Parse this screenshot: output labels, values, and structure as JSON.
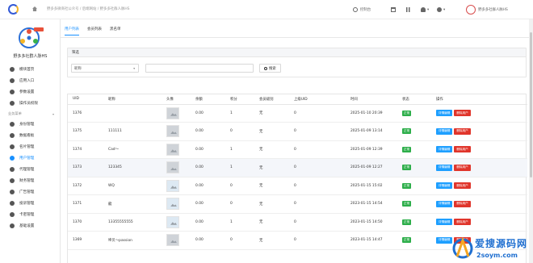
{
  "topbar": {
    "breadcrumb": "野多多微商社公众号 / 后端网站 / 野多多社群人脉HS",
    "links": [
      {
        "icon": "gear-icon",
        "label": "控制台"
      },
      {
        "icon": "calendar-icon",
        "label": ""
      },
      {
        "icon": "grid-icon",
        "label": ""
      },
      {
        "icon": "bell-icon",
        "label": "▾"
      },
      {
        "icon": "user-icon",
        "label": "▾"
      }
    ],
    "user_name": "野多多社群人脉HS"
  },
  "sidebar": {
    "brand_name": "野多多社群人脉HS",
    "top_items": [
      {
        "label": "模块首页",
        "icon": "home-icon"
      },
      {
        "label": "应用入口",
        "icon": "apps-icon"
      },
      {
        "label": "参数设置",
        "icon": "settings-icon"
      },
      {
        "label": "操作员权限",
        "icon": "permission-icon"
      }
    ],
    "group_label": "业务菜单",
    "group_items": [
      {
        "label": "身份管理",
        "icon": "gear-icon"
      },
      {
        "label": "数据看板",
        "icon": "gear-icon"
      },
      {
        "label": "名片管理",
        "icon": "gear-icon"
      },
      {
        "label": "用户管理",
        "icon": "gear-icon",
        "active": true
      },
      {
        "label": "代理管理",
        "icon": "gear-icon"
      },
      {
        "label": "财务管理",
        "icon": "gear-icon"
      },
      {
        "label": "广告管理",
        "icon": "gear-icon"
      },
      {
        "label": "投诉管理",
        "icon": "gear-icon"
      },
      {
        "label": "卡密管理",
        "icon": "gear-icon"
      },
      {
        "label": "基础设置",
        "icon": "gear-icon"
      }
    ]
  },
  "tabs": [
    "用户列表",
    "会员列表",
    "黑名单"
  ],
  "filter": {
    "title": "筛选",
    "select_value": "昵称",
    "input_value": "",
    "search_label": "搜索"
  },
  "table": {
    "headers": [
      "UID",
      "昵称",
      "头像",
      "余额",
      "积分",
      "会员级别",
      "上级UID",
      "时间",
      "状态",
      "操作"
    ],
    "status_label": "正常",
    "detail_label": "详情编辑",
    "delete_label": "删除用户",
    "rows": [
      {
        "uid": "1376",
        "nick": "",
        "balance": "0.00",
        "points": "1",
        "level": "无",
        "parent": "0",
        "time": "2025-01-10 20:39"
      },
      {
        "uid": "1375",
        "nick": "111111",
        "balance": "0.00",
        "points": "0",
        "level": "无",
        "parent": "0",
        "time": "2025-01-09 13:14"
      },
      {
        "uid": "1374",
        "nick": "Cad～",
        "balance": "0.00",
        "points": "1",
        "level": "无",
        "parent": "0",
        "time": "2025-01-09 12:39"
      },
      {
        "uid": "1373",
        "nick": "123345",
        "balance": "0.00",
        "points": "1",
        "level": "无",
        "parent": "0",
        "time": "2025-01-09 12:27"
      },
      {
        "uid": "1372",
        "nick": "WQ",
        "balance": "0.00",
        "points": "0",
        "level": "无",
        "parent": "0",
        "time": "2025-01-15 15:02"
      },
      {
        "uid": "1371",
        "nick": "龍",
        "balance": "0.00",
        "points": "0",
        "level": "无",
        "parent": "0",
        "time": "2023-01-15 14:54"
      },
      {
        "uid": "1370",
        "nick": "13355555555",
        "balance": "0.00",
        "points": "1",
        "level": "无",
        "parent": "0",
        "time": "2023-01-15 14:50"
      },
      {
        "uid": "1369",
        "nick": "坤贝～passion",
        "balance": "0.00",
        "points": "0",
        "level": "无",
        "parent": "0",
        "time": "2023-01-15 14:47"
      }
    ]
  },
  "watermark": {
    "big": "爱搜源码网",
    "small": "2soym.com"
  }
}
